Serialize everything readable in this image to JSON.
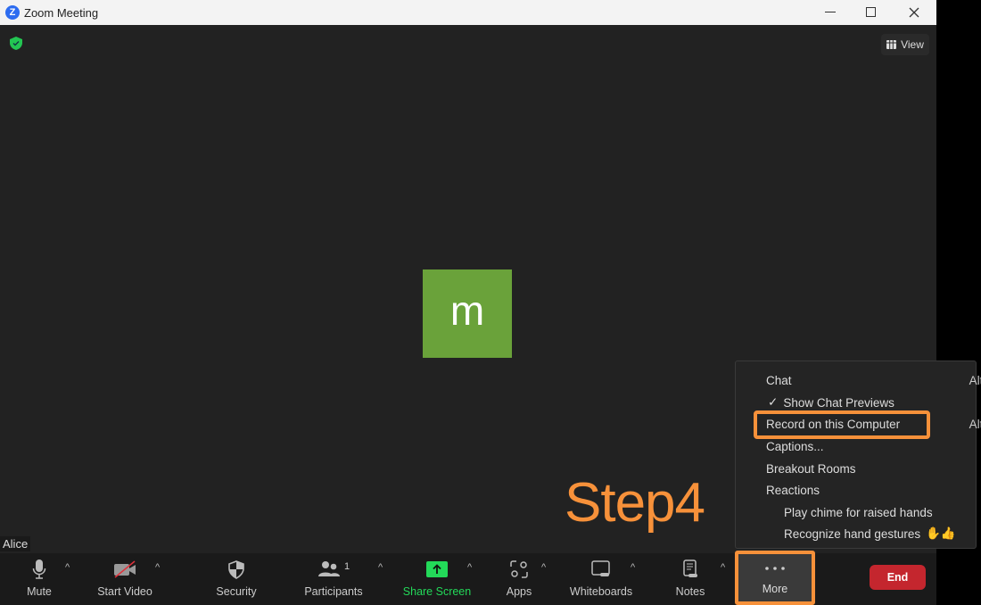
{
  "window": {
    "title": "Zoom Meeting",
    "logo": "Z",
    "controls": [
      "minimize-icon",
      "maximize-icon",
      "close-icon"
    ]
  },
  "header": {
    "view_label": "View"
  },
  "participant": {
    "initial": "m",
    "name": "Alice",
    "avatar_color": "#6aa23a"
  },
  "annotation": {
    "text": "Step4",
    "color": "#f7913a"
  },
  "toolbar": {
    "mute": "Mute",
    "start_video": "Start Video",
    "security": "Security",
    "participants": "Participants",
    "participants_count": "1",
    "share_screen": "Share Screen",
    "apps": "Apps",
    "whiteboards": "Whiteboards",
    "notes": "Notes",
    "more": "More",
    "end": "End"
  },
  "menu": {
    "items": [
      {
        "label": "Chat",
        "shortcut": "Alt+H"
      },
      {
        "label": "Show Chat Previews",
        "checked": true
      },
      {
        "label": "Record on this Computer",
        "shortcut": "Alt+R",
        "highlighted": true
      },
      {
        "label": "Captions..."
      },
      {
        "label": "Breakout Rooms"
      },
      {
        "label": "Reactions"
      },
      {
        "label": "Play chime for raised hands"
      },
      {
        "label": "Recognize hand gestures",
        "emoji": "✋👍"
      }
    ]
  },
  "colors": {
    "share_green": "#23d959",
    "end_red": "#c4262e",
    "highlight_orange": "#f7913a"
  }
}
